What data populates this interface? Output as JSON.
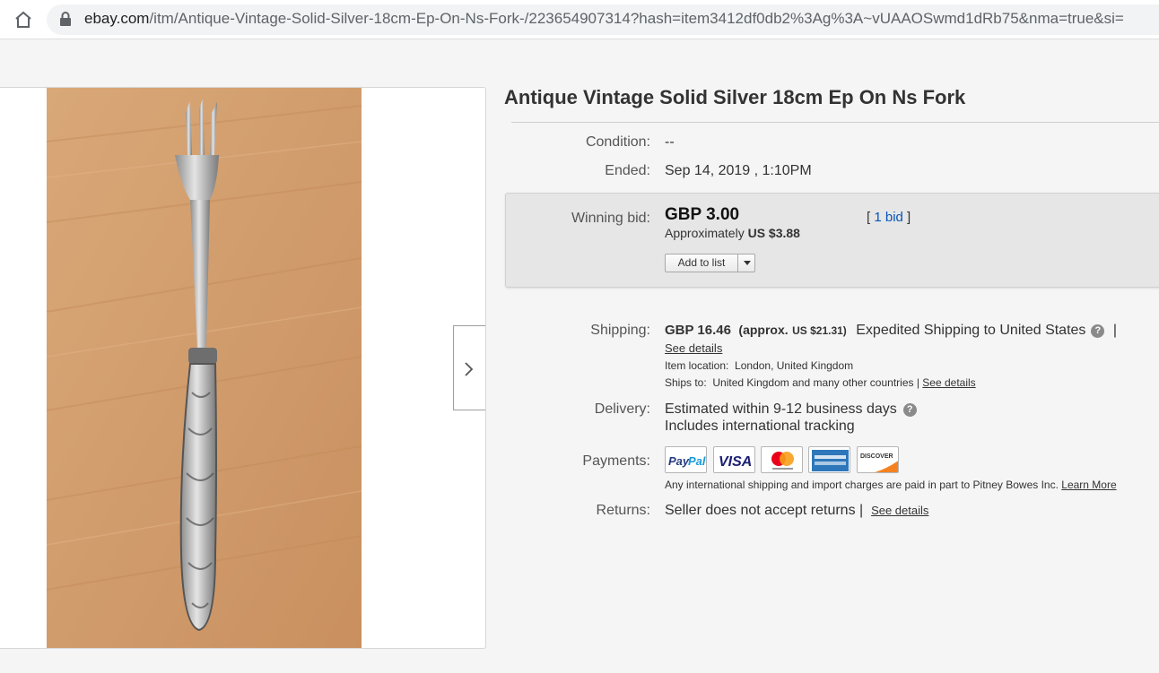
{
  "browser": {
    "url_host": "ebay.com",
    "url_path": "/itm/Antique-Vintage-Solid-Silver-18cm-Ep-On-Ns-Fork-/223654907314?hash=item3412df0db2%3Ag%3A~vUAAOSwmd1dRb75&nma=true&si="
  },
  "listing": {
    "title": "Antique Vintage Solid Silver 18cm Ep On Ns Fork",
    "condition_label": "Condition:",
    "condition_value": "--",
    "ended_label": "Ended:",
    "ended_value": "Sep 14, 2019 , 1:10PM",
    "winning_bid_label": "Winning bid:",
    "price": "GBP 3.00",
    "approx_prefix": "Approximately",
    "approx_value": "US $3.88",
    "bids_open": "[",
    "bids_link": "1 bid",
    "bids_close": "]",
    "add_to_list": "Add to list"
  },
  "shipping": {
    "label": "Shipping:",
    "cost": "GBP 16.46",
    "approx": "(approx.",
    "approx_usd": "US $21.31)",
    "method": "Expedited Shipping to United States",
    "pipe": "|",
    "see_details": "See details",
    "location_label": "Item location:",
    "location_value": "London, United Kingdom",
    "ships_label": "Ships to:",
    "ships_value": "United Kingdom and many other countries |",
    "ships_see_details": "See details"
  },
  "delivery": {
    "label": "Delivery:",
    "estimate": "Estimated within 9-12 business days",
    "tracking": "Includes international tracking"
  },
  "payments": {
    "label": "Payments:",
    "methods": [
      "PayPal",
      "VISA",
      "Mastercard",
      "American Express",
      "Discover"
    ],
    "note": "Any international shipping and import charges are paid in part to Pitney Bowes Inc.",
    "learn_more": "Learn More"
  },
  "returns": {
    "label": "Returns:",
    "value": "Seller does not accept returns |",
    "see_details": "See details"
  },
  "colors": {
    "link_blue": "#0654ba",
    "bid_box_bg": "#e6e6e6",
    "paypal_blue": "#253b80",
    "paypal_light": "#179bd7",
    "visa_blue": "#1a1f71",
    "mc_red": "#eb001b",
    "mc_orange": "#f79e1b",
    "amex_blue": "#2e77bb",
    "discover_orange": "#f58220"
  }
}
